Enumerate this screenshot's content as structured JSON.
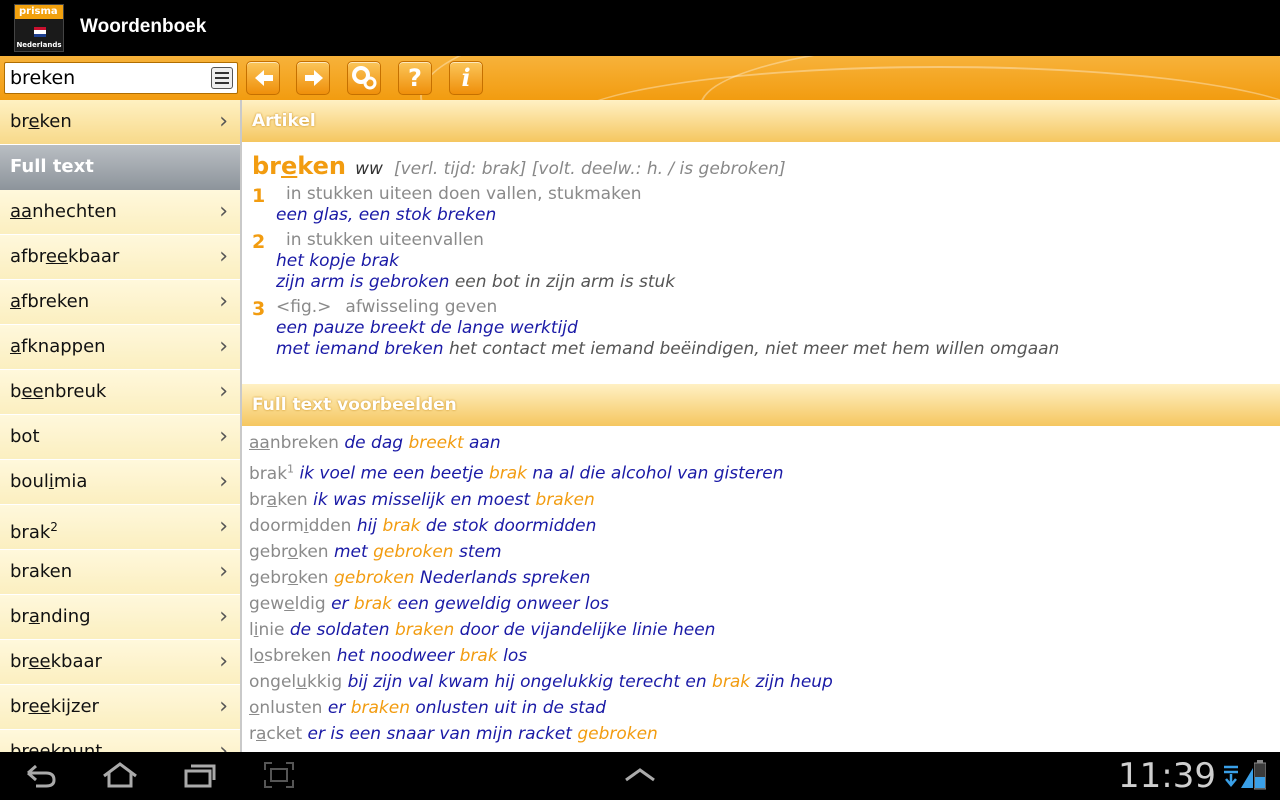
{
  "app": {
    "title": "Woordenboek",
    "logo_brand": "prisma",
    "logo_sub": "Nederlands",
    "accent": "#f29c10"
  },
  "toolbar": {
    "search": {
      "value": "breken",
      "icon": "list-icon"
    },
    "buttons": [
      {
        "name": "back-button",
        "icon": "arrow-left-icon"
      },
      {
        "name": "forward-button",
        "icon": "arrow-right-icon"
      },
      {
        "name": "settings-button",
        "icon": "gears-icon"
      },
      {
        "name": "help-button",
        "icon": "question-icon",
        "glyph": "?"
      },
      {
        "name": "info-button",
        "icon": "info-icon",
        "glyph": "i"
      }
    ]
  },
  "sidebar": {
    "selected": {
      "pre": "br",
      "u": "e",
      "post": "ken"
    },
    "header": "Full text",
    "items": [
      {
        "pre": "",
        "u": "aa",
        "post": "nhechten"
      },
      {
        "pre": "afbr",
        "u": "ee",
        "post": "kbaar"
      },
      {
        "pre": "",
        "u": "a",
        "post": "fbreken"
      },
      {
        "pre": "",
        "u": "a",
        "post": "fknappen"
      },
      {
        "pre": "b",
        "u": "ee",
        "post": "nbreuk"
      },
      {
        "pre": "bot",
        "u": "",
        "post": ""
      },
      {
        "pre": "boul",
        "u": "i",
        "post": "mia"
      },
      {
        "pre": "brak",
        "u": "",
        "post": "",
        "sup": "2"
      },
      {
        "pre": "braken",
        "u": "",
        "post": ""
      },
      {
        "pre": "br",
        "u": "a",
        "post": "nding"
      },
      {
        "pre": "br",
        "u": "ee",
        "post": "kbaar"
      },
      {
        "pre": "br",
        "u": "ee",
        "post": "kijzer"
      },
      {
        "pre": "breekpunt",
        "u": "",
        "post": ""
      }
    ]
  },
  "article": {
    "section_title": "Artikel",
    "headword": {
      "pre": "br",
      "u": "e",
      "post": "ken"
    },
    "pos": "ww",
    "grammar": "[verl. tijd: brak] [volt. deelw.: h. / is gebroken]",
    "senses": [
      {
        "num": "1",
        "label": "",
        "def": "in stukken uiteen doen vallen, stukmaken",
        "examples": [
          {
            "ex": "een glas, een stok breken",
            "gloss": ""
          }
        ]
      },
      {
        "num": "2",
        "label": "",
        "def": "in stukken uiteenvallen",
        "examples": [
          {
            "ex": "het kopje brak",
            "gloss": ""
          },
          {
            "ex": "zijn arm is gebroken",
            "gloss": "een bot in zijn arm is stuk"
          }
        ]
      },
      {
        "num": "3",
        "label": "<fig.>",
        "def": "afwisseling geven",
        "examples": [
          {
            "ex": "een pauze breekt de lange werktijd",
            "gloss": ""
          },
          {
            "ex": "met iemand breken",
            "gloss": "het contact met iemand beëindigen, niet meer met hem willen omgaan"
          }
        ]
      }
    ]
  },
  "fulltext": {
    "section_title": "Full text voorbeelden",
    "rows": [
      {
        "lemma": [
          [
            "aa",
            "u"
          ],
          [
            "nbreken",
            ""
          ]
        ],
        "parts": [
          [
            "de dag ",
            "ex"
          ],
          [
            "breekt",
            "hl"
          ],
          [
            " aan",
            "ex"
          ]
        ]
      },
      {
        "lemma": [
          [
            "brak",
            ""
          ]
        ],
        "sup": "1",
        "parts": [
          [
            "ik voel me een beetje ",
            "ex"
          ],
          [
            "brak",
            "hl"
          ],
          [
            " na al die alcohol van gisteren",
            "ex"
          ]
        ]
      },
      {
        "lemma": [
          [
            "br",
            ""
          ],
          [
            "a",
            "u"
          ],
          [
            "ken",
            ""
          ]
        ],
        "parts": [
          [
            "ik was misselijk en moest ",
            "ex"
          ],
          [
            "braken",
            "hl"
          ]
        ]
      },
      {
        "lemma": [
          [
            "doorm",
            ""
          ],
          [
            "i",
            "u"
          ],
          [
            "dden",
            ""
          ]
        ],
        "parts": [
          [
            "hij ",
            "ex"
          ],
          [
            "brak",
            "hl"
          ],
          [
            " de stok doormidden",
            "ex"
          ]
        ]
      },
      {
        "lemma": [
          [
            "gebr",
            ""
          ],
          [
            "o",
            "u"
          ],
          [
            "ken",
            ""
          ]
        ],
        "parts": [
          [
            "met ",
            "ex"
          ],
          [
            "gebroken",
            "hl"
          ],
          [
            " stem",
            "ex"
          ]
        ]
      },
      {
        "lemma": [
          [
            "gebr",
            ""
          ],
          [
            "o",
            "u"
          ],
          [
            "ken",
            ""
          ]
        ],
        "parts": [
          [
            "gebroken",
            "hl"
          ],
          [
            " Nederlands spreken",
            "ex"
          ]
        ]
      },
      {
        "lemma": [
          [
            "gew",
            ""
          ],
          [
            "e",
            "u"
          ],
          [
            "ldig",
            ""
          ]
        ],
        "parts": [
          [
            "er ",
            "ex"
          ],
          [
            "brak",
            "hl"
          ],
          [
            " een geweldig onweer los",
            "ex"
          ]
        ]
      },
      {
        "lemma": [
          [
            "l",
            ""
          ],
          [
            "i",
            "u"
          ],
          [
            "nie",
            ""
          ]
        ],
        "parts": [
          [
            "de soldaten ",
            "ex"
          ],
          [
            "braken",
            "hl"
          ],
          [
            " door de vijandelijke linie heen",
            "ex"
          ]
        ]
      },
      {
        "lemma": [
          [
            "l",
            ""
          ],
          [
            "o",
            "u"
          ],
          [
            "sbreken",
            ""
          ]
        ],
        "parts": [
          [
            "het noodweer ",
            "ex"
          ],
          [
            "brak",
            "hl"
          ],
          [
            " los",
            "ex"
          ]
        ]
      },
      {
        "lemma": [
          [
            "ongel",
            ""
          ],
          [
            "u",
            "u"
          ],
          [
            "kkig",
            ""
          ]
        ],
        "parts": [
          [
            "bij zijn val kwam hij ongelukkig terecht en ",
            "ex"
          ],
          [
            "brak",
            "hl"
          ],
          [
            " zijn heup",
            "ex"
          ]
        ]
      },
      {
        "lemma": [
          [
            "o",
            "u"
          ],
          [
            "nlusten",
            ""
          ]
        ],
        "parts": [
          [
            "er ",
            "ex"
          ],
          [
            "braken",
            "hl"
          ],
          [
            " onlusten uit in de stad",
            "ex"
          ]
        ]
      },
      {
        "lemma": [
          [
            "r",
            ""
          ],
          [
            "a",
            "u"
          ],
          [
            "cket",
            ""
          ]
        ],
        "parts": [
          [
            "er is een snaar van mijn racket ",
            "ex"
          ],
          [
            "gebroken",
            "hl"
          ]
        ]
      }
    ]
  },
  "statusbar": {
    "clock": "11:39",
    "icons": [
      "back-nav-icon",
      "home-icon",
      "recent-apps-icon",
      "screenshot-icon",
      "chevron-up-icon",
      "download-icon",
      "signal-icon",
      "battery-icon"
    ]
  }
}
